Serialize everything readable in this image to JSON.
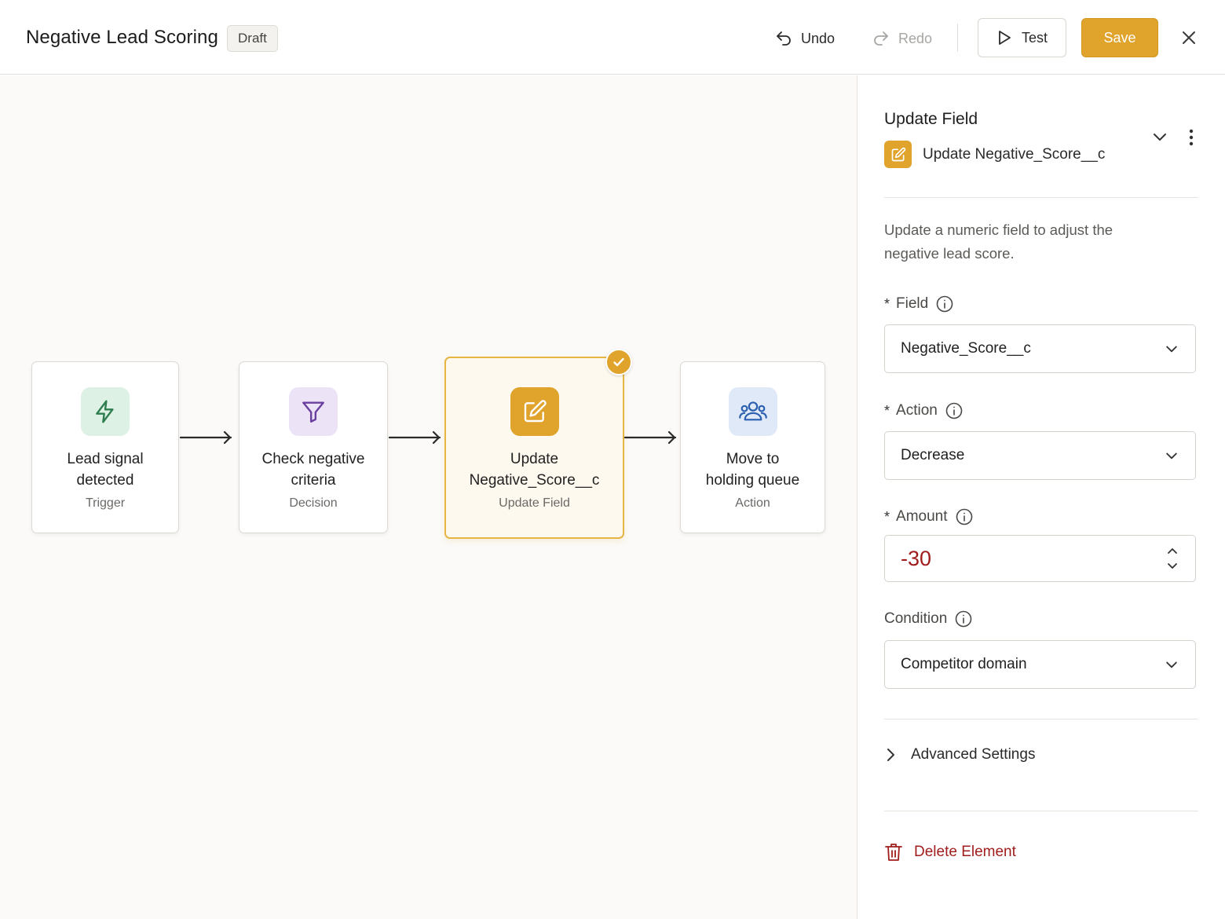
{
  "header": {
    "title": "Negative Lead Scoring",
    "status_badge": "Draft",
    "undo_label": "Undo",
    "redo_label": "Redo",
    "test_label": "Test",
    "save_label": "Save"
  },
  "flow": {
    "nodes": [
      {
        "title_line1": "Lead signal",
        "title_line2": "detected",
        "subtitle": "Trigger",
        "icon": "lightning-icon",
        "icon_bg": "#ddf1e4",
        "icon_color": "#2e7d4f"
      },
      {
        "title_line1": "Check negative",
        "title_line2": "criteria",
        "subtitle": "Decision",
        "icon": "filter-icon",
        "icon_bg": "#ece3f6",
        "icon_color": "#6b3fa0"
      },
      {
        "title_line1": "Update",
        "title_line2": "Negative_Score__c",
        "subtitle": "Update Field",
        "icon": "edit-icon",
        "icon_bg": "#e0a32b",
        "icon_color": "#ffffff",
        "selected": true
      },
      {
        "title_line1": "Move to",
        "title_line2": "holding queue",
        "subtitle": "Action",
        "icon": "users-icon",
        "icon_bg": "#dfe9f8",
        "icon_color": "#2a5fb0"
      }
    ]
  },
  "panel": {
    "title": "Update Field",
    "element_name": "Update Negative_Score__c",
    "description": "Update a numeric field to adjust the negative lead score.",
    "field": {
      "label": "Field",
      "required_mark": "*",
      "value": "Negative_Score__c"
    },
    "action": {
      "label": "Action",
      "required_mark": "*",
      "value": "Decrease"
    },
    "amount": {
      "label": "Amount",
      "required_mark": "*",
      "value": "-30"
    },
    "condition": {
      "label": "Condition",
      "value": "Competitor domain"
    },
    "advanced_label": "Advanced Settings",
    "delete_label": "Delete Element"
  },
  "colors": {
    "accent": "#e0a32b",
    "danger": "#a11d1d"
  }
}
